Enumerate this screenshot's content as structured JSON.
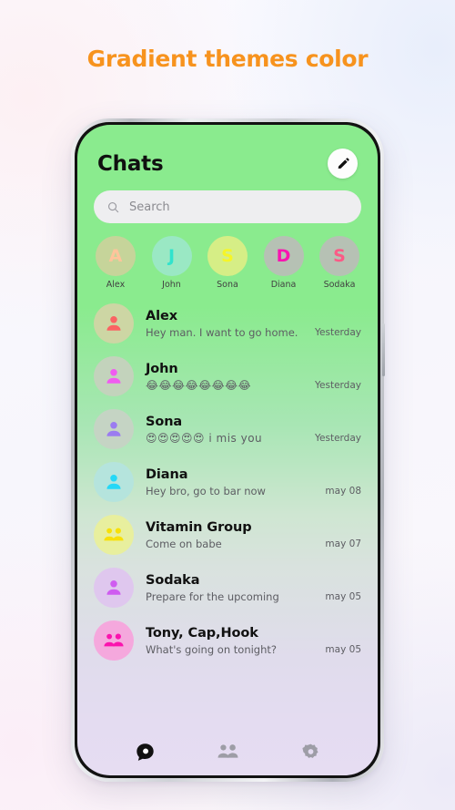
{
  "page": {
    "title": "Gradient themes color",
    "title_color": "#f7931e",
    "background_gradient_top": "#8aeb8e",
    "background_gradient_bottom": "#e6ddf2"
  },
  "header": {
    "title": "Chats",
    "edit_icon": "pencil-icon"
  },
  "search": {
    "placeholder": "Search",
    "icon": "search-icon"
  },
  "stories": [
    {
      "initial": "A",
      "name": "Alex",
      "circle_color": "#c6d49a",
      "initial_color": "#ffc49b"
    },
    {
      "initial": "J",
      "name": "John",
      "circle_color": "#9ae8c4",
      "initial_color": "#31e3cd"
    },
    {
      "initial": "S",
      "name": "Sona",
      "circle_color": "#d6ee86",
      "initial_color": "#f6f527"
    },
    {
      "initial": "D",
      "name": "Diana",
      "circle_color": "#b6c1b4",
      "initial_color": "#f715b0"
    },
    {
      "initial": "S",
      "name": "Sodaka",
      "circle_color": "#b6c1b4",
      "initial_color": "#fb5a86"
    }
  ],
  "chats": [
    {
      "name": "Alex",
      "preview": "Hey man. I want to go home.",
      "time": "Yesterday",
      "avatar_bg": "#cdd6a4",
      "icon_color": "#fa6363",
      "icon": "person-icon",
      "emoji": false
    },
    {
      "name": "John",
      "preview": "😂😂😂😂😂😂😂😂",
      "time": "Yesterday",
      "avatar_bg": "#c3d3bc",
      "icon_color": "#f05cf0",
      "icon": "person-icon",
      "emoji": true
    },
    {
      "name": "Sona",
      "preview": "😍😍😍😍😍 i mis you",
      "time": "Yesterday",
      "avatar_bg": "#c5d4c4",
      "icon_color": "#9b7cf0",
      "icon": "person-icon",
      "emoji": true
    },
    {
      "name": "Diana",
      "preview": "Hey bro, go to bar now",
      "time": "may 08",
      "avatar_bg": "#b5e4dd",
      "icon_color": "#25d8f7",
      "icon": "person-icon",
      "emoji": false
    },
    {
      "name": "Vitamin Group",
      "preview": "Come on babe",
      "time": "may 07",
      "avatar_bg": "#e8ef9e",
      "icon_color": "#f8e008",
      "icon": "group-icon",
      "emoji": false
    },
    {
      "name": "Sodaka",
      "preview": "Prepare for the upcoming",
      "time": "may 05",
      "avatar_bg": "#dfc7ee",
      "icon_color": "#cf5cf0",
      "icon": "person-icon",
      "emoji": false
    },
    {
      "name": "Tony, Cap,Hook",
      "preview": "What's going on tonight?",
      "time": "may 05",
      "avatar_bg": "#f5a8dd",
      "icon_color": "#fb13ae",
      "icon": "group-icon",
      "emoji": false
    }
  ],
  "bottom_nav": [
    {
      "name": "chats",
      "icon": "chat-bubble-icon",
      "active": true,
      "color": "#111111"
    },
    {
      "name": "contacts",
      "icon": "people-icon",
      "active": false,
      "color": "#9d9da6"
    },
    {
      "name": "settings",
      "icon": "gear-icon",
      "active": false,
      "color": "#9d9da6"
    }
  ]
}
